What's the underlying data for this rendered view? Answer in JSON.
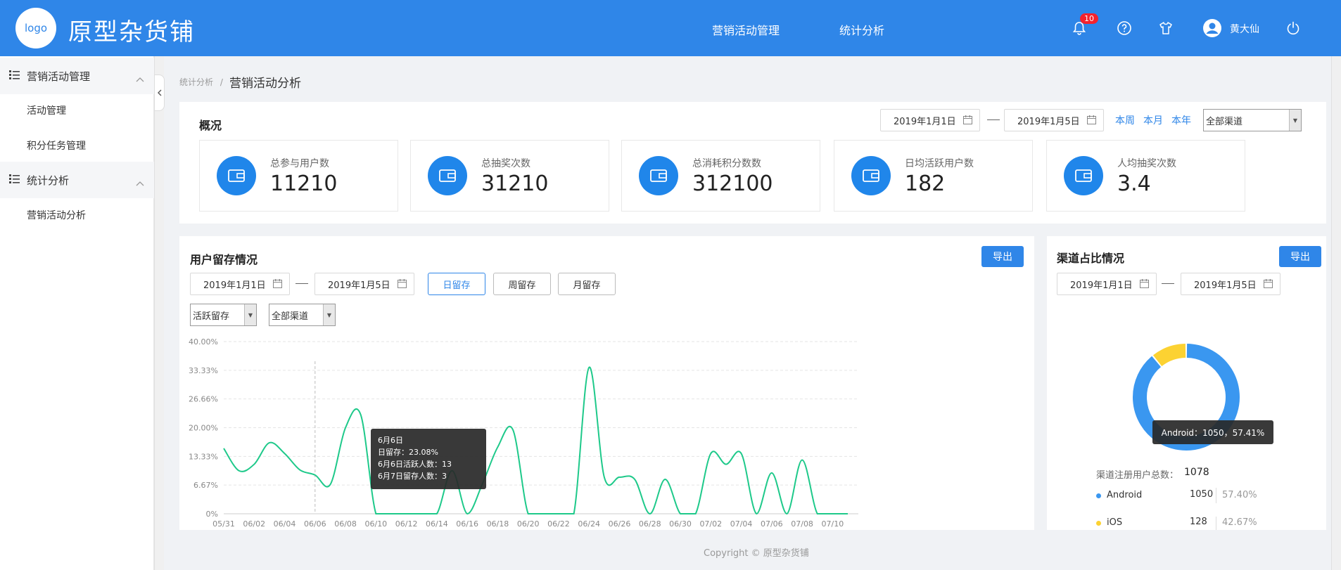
{
  "header": {
    "logo": "logo",
    "brand": "原型杂货铺",
    "nav": [
      "营销活动管理",
      "统计分析"
    ],
    "notification_count": "10",
    "user": "黄大仙"
  },
  "sidebar": {
    "groups": [
      {
        "label": "营销活动管理",
        "items": [
          "活动管理",
          "积分任务管理"
        ]
      },
      {
        "label": "统计分析",
        "items": [
          "营销活动分析"
        ]
      }
    ]
  },
  "breadcrumb": {
    "parent": "统计分析",
    "separator": "/",
    "current": "营销活动分析"
  },
  "overview": {
    "title": "概况",
    "date_start": "2019年1月1日",
    "date_end": "2019年1月5日",
    "quick_links": [
      "本周",
      "本月",
      "本年"
    ],
    "channel": "全部渠道",
    "stats": [
      {
        "label": "总参与用户数",
        "value": "11210"
      },
      {
        "label": "总抽奖次数",
        "value": "31210"
      },
      {
        "label": "总消耗积分数数",
        "value": "312100"
      },
      {
        "label": "日均活跃用户数",
        "value": "182"
      },
      {
        "label": "人均抽奖次数",
        "value": "3.4"
      }
    ]
  },
  "retention": {
    "title": "用户留存情况",
    "export": "导出",
    "date_start": "2019年1月1日",
    "date_end": "2019年1月5日",
    "tabs": [
      "日留存",
      "周留存",
      "月留存"
    ],
    "active_tab": "日留存",
    "type_select": "活跃留存",
    "channel_select": "全部渠道",
    "tooltip": {
      "title": "6月6日",
      "lines": [
        "日留存：23.08%",
        "6月6日活跃人数：13",
        "6月7日留存人数：3"
      ]
    }
  },
  "channel": {
    "title": "渠道占比情况",
    "export": "导出",
    "date_start": "2019年1月1日",
    "date_end": "2019年1月5日",
    "tooltip": "Android：1050，57.41%",
    "total_label": "渠道注册用户总数：",
    "total_value": "1078",
    "legend": [
      {
        "name": "Android",
        "count": "1050",
        "percent": "57.40%",
        "color": "#3a97f0"
      },
      {
        "name": "iOS",
        "count": "128",
        "percent": "42.67%",
        "color": "#fcd232"
      }
    ]
  },
  "footer": "Copyright © 原型杂货铺",
  "chart_data": [
    {
      "type": "line",
      "x": [
        "05/31",
        "06/01",
        "06/02",
        "06/03",
        "06/04",
        "06/05",
        "06/06",
        "06/07",
        "06/08",
        "06/09",
        "06/10",
        "06/11",
        "06/12",
        "06/13",
        "06/14",
        "06/15",
        "06/16",
        "06/17",
        "06/18",
        "06/19",
        "06/20",
        "06/21",
        "06/22",
        "06/23",
        "06/24",
        "06/25",
        "06/26",
        "06/27",
        "06/28",
        "06/29",
        "06/30",
        "07/01",
        "07/02",
        "07/03",
        "07/04",
        "07/05",
        "07/06",
        "07/07",
        "07/08",
        "07/09",
        "07/10",
        "07/11"
      ],
      "x_tick_labels": [
        "05/31",
        "06/02",
        "06/04",
        "06/06",
        "06/08",
        "06/10",
        "06/12",
        "06/14",
        "06/16",
        "06/18",
        "06/20",
        "06/22",
        "06/24",
        "06/26",
        "06/28",
        "06/30",
        "07/02",
        "07/04",
        "07/06",
        "07/08",
        "07/10"
      ],
      "y_tick_labels": [
        "0%",
        "6.67%",
        "13.33%",
        "20.00%",
        "26.66%",
        "33.33%",
        "40.00%"
      ],
      "ylim": [
        0,
        40
      ],
      "series": [
        {
          "values": [
            15.2,
            10,
            11.5,
            16.5,
            14,
            10.2,
            9,
            6.8,
            20,
            23,
            0,
            0,
            0,
            0,
            0,
            10,
            0,
            7,
            15.5,
            19.5,
            0,
            0,
            0,
            0,
            34,
            8.5,
            8.5,
            8,
            0,
            8,
            0,
            0,
            14,
            11.5,
            14,
            0,
            9.5,
            0,
            12.5,
            0,
            0,
            0
          ],
          "color": "#1ec98a"
        }
      ],
      "grid": true,
      "highlight_x": "06/06"
    },
    {
      "type": "pie",
      "categories": [
        "Android",
        "iOS"
      ],
      "values": [
        1050,
        128
      ],
      "colors": [
        "#3a97f0",
        "#fcd232"
      ]
    }
  ]
}
